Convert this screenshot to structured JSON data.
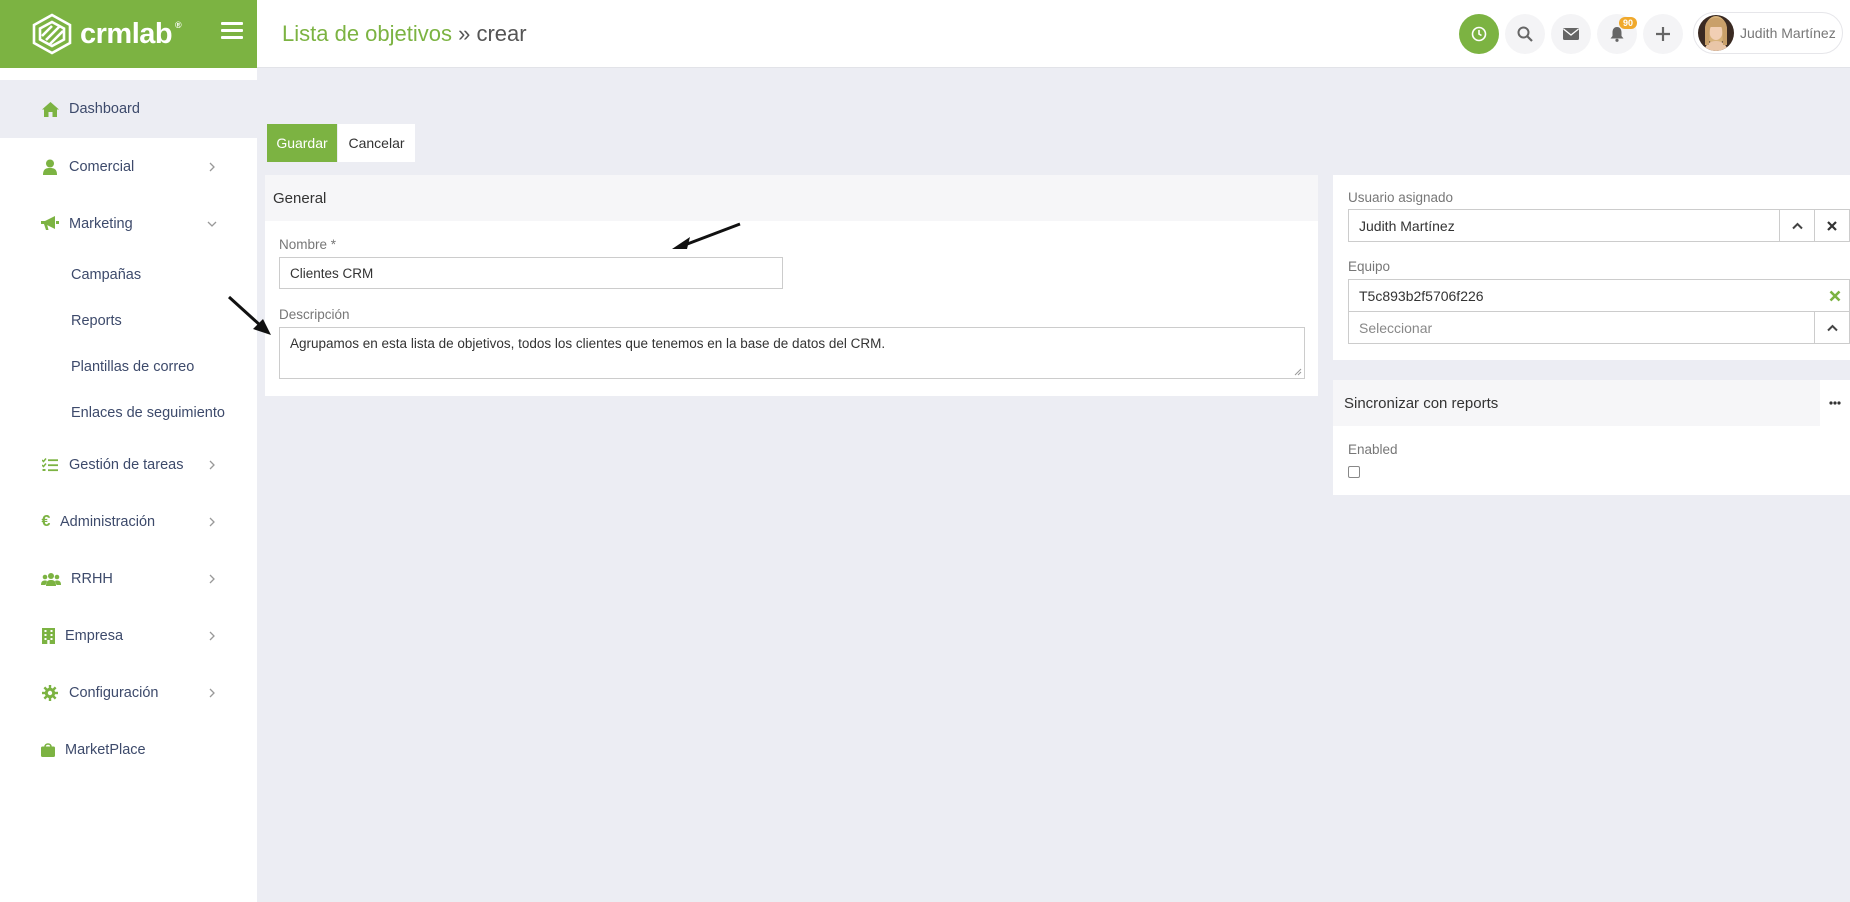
{
  "brand": {
    "name": "crmlab",
    "mark": "®"
  },
  "sidebar": {
    "items": [
      {
        "label": "Dashboard",
        "icon": "home-icon"
      },
      {
        "label": "Comercial",
        "icon": "user-icon"
      },
      {
        "label": "Marketing",
        "icon": "megaphone-icon"
      },
      {
        "label": "Gestión de tareas",
        "icon": "tasks-icon"
      },
      {
        "label": "Administración",
        "icon": "euro-icon"
      },
      {
        "label": "RRHH",
        "icon": "users-icon"
      },
      {
        "label": "Empresa",
        "icon": "building-icon"
      },
      {
        "label": "Configuración",
        "icon": "gear-icon"
      },
      {
        "label": "MarketPlace",
        "icon": "bag-icon"
      }
    ],
    "marketing_sub": [
      "Campañas",
      "Reports",
      "Plantillas de correo",
      "Enlaces de seguimiento"
    ]
  },
  "header": {
    "title_link": "Lista de objetivos",
    "title_rest": " » crear",
    "notifications_count": "90",
    "user_name": "Judith Martínez"
  },
  "actions": {
    "save": "Guardar",
    "cancel": "Cancelar"
  },
  "general": {
    "heading": "General",
    "name_label": "Nombre *",
    "name_value": "Clientes CRM",
    "description_label": "Descripción",
    "description_value": "Agrupamos en esta lista de objetivos, todos los clientes que tenemos en la base de datos del CRM."
  },
  "assign": {
    "user_label": "Usuario asignado",
    "user_value": "Judith Martínez",
    "team_label": "Equipo",
    "team_value": "T5c893b2f5706f226",
    "team_placeholder": "Seleccionar"
  },
  "sync": {
    "heading": "Sincronizar con reports",
    "enabled_label": "Enabled",
    "enabled": false
  },
  "colors": {
    "accent": "#7cb342",
    "badge": "#f0a92c",
    "nav_text": "#3d4a6b"
  }
}
